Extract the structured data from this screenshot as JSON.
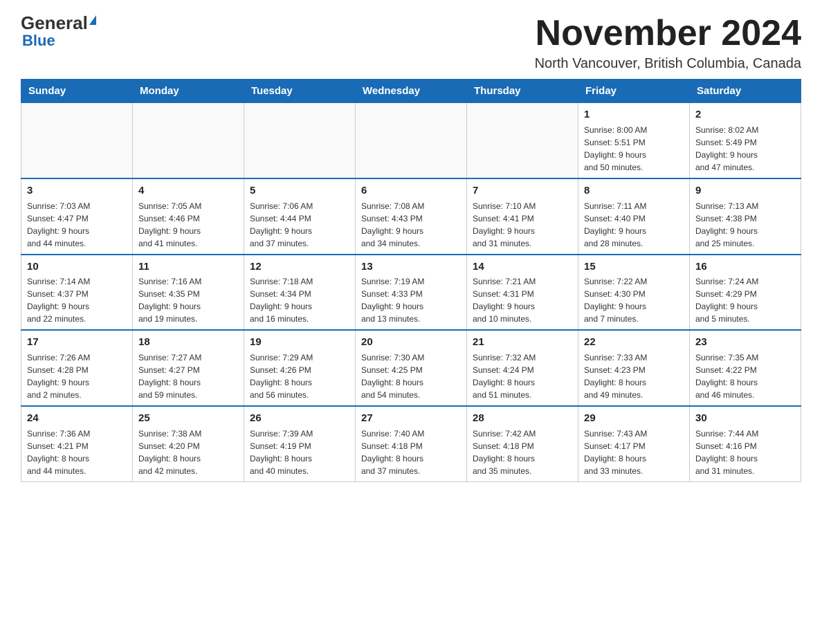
{
  "logo": {
    "name": "General",
    "name2": "Blue"
  },
  "title": "November 2024",
  "location": "North Vancouver, British Columbia, Canada",
  "days_of_week": [
    "Sunday",
    "Monday",
    "Tuesday",
    "Wednesday",
    "Thursday",
    "Friday",
    "Saturday"
  ],
  "weeks": [
    [
      {
        "day": "",
        "info": ""
      },
      {
        "day": "",
        "info": ""
      },
      {
        "day": "",
        "info": ""
      },
      {
        "day": "",
        "info": ""
      },
      {
        "day": "",
        "info": ""
      },
      {
        "day": "1",
        "info": "Sunrise: 8:00 AM\nSunset: 5:51 PM\nDaylight: 9 hours\nand 50 minutes."
      },
      {
        "day": "2",
        "info": "Sunrise: 8:02 AM\nSunset: 5:49 PM\nDaylight: 9 hours\nand 47 minutes."
      }
    ],
    [
      {
        "day": "3",
        "info": "Sunrise: 7:03 AM\nSunset: 4:47 PM\nDaylight: 9 hours\nand 44 minutes."
      },
      {
        "day": "4",
        "info": "Sunrise: 7:05 AM\nSunset: 4:46 PM\nDaylight: 9 hours\nand 41 minutes."
      },
      {
        "day": "5",
        "info": "Sunrise: 7:06 AM\nSunset: 4:44 PM\nDaylight: 9 hours\nand 37 minutes."
      },
      {
        "day": "6",
        "info": "Sunrise: 7:08 AM\nSunset: 4:43 PM\nDaylight: 9 hours\nand 34 minutes."
      },
      {
        "day": "7",
        "info": "Sunrise: 7:10 AM\nSunset: 4:41 PM\nDaylight: 9 hours\nand 31 minutes."
      },
      {
        "day": "8",
        "info": "Sunrise: 7:11 AM\nSunset: 4:40 PM\nDaylight: 9 hours\nand 28 minutes."
      },
      {
        "day": "9",
        "info": "Sunrise: 7:13 AM\nSunset: 4:38 PM\nDaylight: 9 hours\nand 25 minutes."
      }
    ],
    [
      {
        "day": "10",
        "info": "Sunrise: 7:14 AM\nSunset: 4:37 PM\nDaylight: 9 hours\nand 22 minutes."
      },
      {
        "day": "11",
        "info": "Sunrise: 7:16 AM\nSunset: 4:35 PM\nDaylight: 9 hours\nand 19 minutes."
      },
      {
        "day": "12",
        "info": "Sunrise: 7:18 AM\nSunset: 4:34 PM\nDaylight: 9 hours\nand 16 minutes."
      },
      {
        "day": "13",
        "info": "Sunrise: 7:19 AM\nSunset: 4:33 PM\nDaylight: 9 hours\nand 13 minutes."
      },
      {
        "day": "14",
        "info": "Sunrise: 7:21 AM\nSunset: 4:31 PM\nDaylight: 9 hours\nand 10 minutes."
      },
      {
        "day": "15",
        "info": "Sunrise: 7:22 AM\nSunset: 4:30 PM\nDaylight: 9 hours\nand 7 minutes."
      },
      {
        "day": "16",
        "info": "Sunrise: 7:24 AM\nSunset: 4:29 PM\nDaylight: 9 hours\nand 5 minutes."
      }
    ],
    [
      {
        "day": "17",
        "info": "Sunrise: 7:26 AM\nSunset: 4:28 PM\nDaylight: 9 hours\nand 2 minutes."
      },
      {
        "day": "18",
        "info": "Sunrise: 7:27 AM\nSunset: 4:27 PM\nDaylight: 8 hours\nand 59 minutes."
      },
      {
        "day": "19",
        "info": "Sunrise: 7:29 AM\nSunset: 4:26 PM\nDaylight: 8 hours\nand 56 minutes."
      },
      {
        "day": "20",
        "info": "Sunrise: 7:30 AM\nSunset: 4:25 PM\nDaylight: 8 hours\nand 54 minutes."
      },
      {
        "day": "21",
        "info": "Sunrise: 7:32 AM\nSunset: 4:24 PM\nDaylight: 8 hours\nand 51 minutes."
      },
      {
        "day": "22",
        "info": "Sunrise: 7:33 AM\nSunset: 4:23 PM\nDaylight: 8 hours\nand 49 minutes."
      },
      {
        "day": "23",
        "info": "Sunrise: 7:35 AM\nSunset: 4:22 PM\nDaylight: 8 hours\nand 46 minutes."
      }
    ],
    [
      {
        "day": "24",
        "info": "Sunrise: 7:36 AM\nSunset: 4:21 PM\nDaylight: 8 hours\nand 44 minutes."
      },
      {
        "day": "25",
        "info": "Sunrise: 7:38 AM\nSunset: 4:20 PM\nDaylight: 8 hours\nand 42 minutes."
      },
      {
        "day": "26",
        "info": "Sunrise: 7:39 AM\nSunset: 4:19 PM\nDaylight: 8 hours\nand 40 minutes."
      },
      {
        "day": "27",
        "info": "Sunrise: 7:40 AM\nSunset: 4:18 PM\nDaylight: 8 hours\nand 37 minutes."
      },
      {
        "day": "28",
        "info": "Sunrise: 7:42 AM\nSunset: 4:18 PM\nDaylight: 8 hours\nand 35 minutes."
      },
      {
        "day": "29",
        "info": "Sunrise: 7:43 AM\nSunset: 4:17 PM\nDaylight: 8 hours\nand 33 minutes."
      },
      {
        "day": "30",
        "info": "Sunrise: 7:44 AM\nSunset: 4:16 PM\nDaylight: 8 hours\nand 31 minutes."
      }
    ]
  ]
}
